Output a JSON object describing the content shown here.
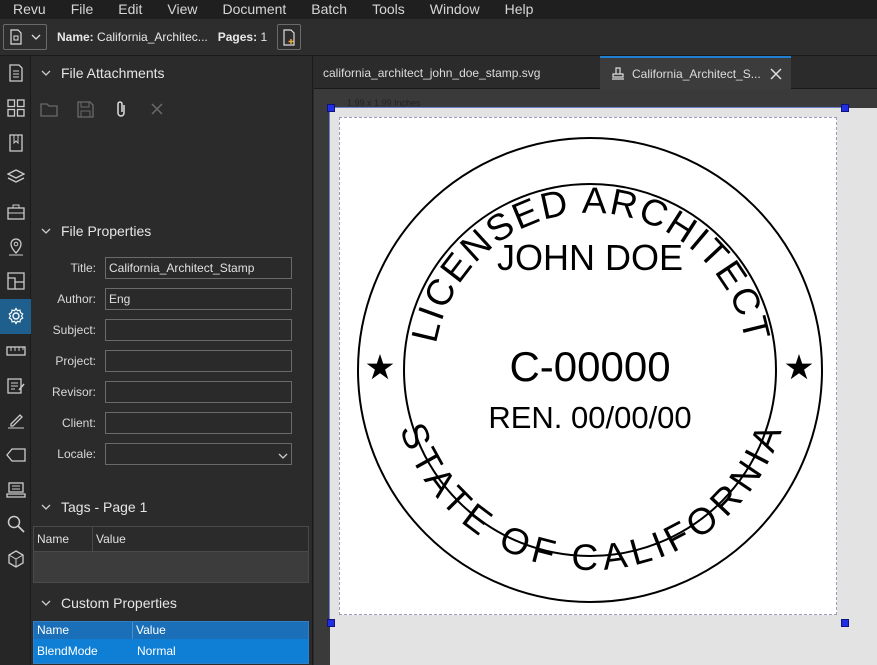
{
  "menu": [
    "Revu",
    "File",
    "Edit",
    "View",
    "Document",
    "Batch",
    "Tools",
    "Window",
    "Help"
  ],
  "toolbar": {
    "name_label": "Name:",
    "name_value": "California_Architec...",
    "pages_label": "Pages:",
    "pages_value": "1"
  },
  "sidebar_icons": [
    "thumbnails-icon",
    "grid-icon",
    "bookmarks-icon",
    "layers-icon",
    "toolchest-icon",
    "places-icon",
    "sheets-icon",
    "properties-icon",
    "measurements-icon",
    "markups-list-icon",
    "signatures-icon",
    "tags-icon",
    "studio-icon",
    "search-icon",
    "3d-icon"
  ],
  "panel": {
    "file_attachments": {
      "title": "File Attachments"
    },
    "file_properties": {
      "title": "File Properties",
      "rows": [
        {
          "label": "Title:",
          "value": "California_Architect_Stamp"
        },
        {
          "label": "Author:",
          "value": "Eng"
        },
        {
          "label": "Subject:",
          "value": ""
        },
        {
          "label": "Project:",
          "value": ""
        },
        {
          "label": "Revisor:",
          "value": ""
        },
        {
          "label": "Client:",
          "value": ""
        },
        {
          "label": "Locale:",
          "value": ""
        }
      ]
    },
    "tags": {
      "title": "Tags - Page 1",
      "col_name": "Name",
      "col_value": "Value"
    },
    "custom_properties": {
      "title": "Custom Properties",
      "col_name": "Name",
      "col_value": "Value",
      "rows": [
        {
          "name": "BlendMode",
          "value": "Normal"
        }
      ]
    }
  },
  "tabs": [
    {
      "label": "california_architect_john_doe_stamp.svg",
      "active": false
    },
    {
      "label": "California_Architect_S...",
      "active": true
    }
  ],
  "document": {
    "dimensions": "1.99 x 1.99 Inches",
    "stamp": {
      "top_arc": "LICENSED ARCHITECT",
      "bottom_arc": "STATE OF CALIFORNIA",
      "name": "JOHN DOE",
      "license": "C-00000",
      "renewal": "REN. 00/00/00"
    }
  },
  "colors": {
    "accent": "#1f7fd0",
    "selection_handle": "#2030e0"
  }
}
